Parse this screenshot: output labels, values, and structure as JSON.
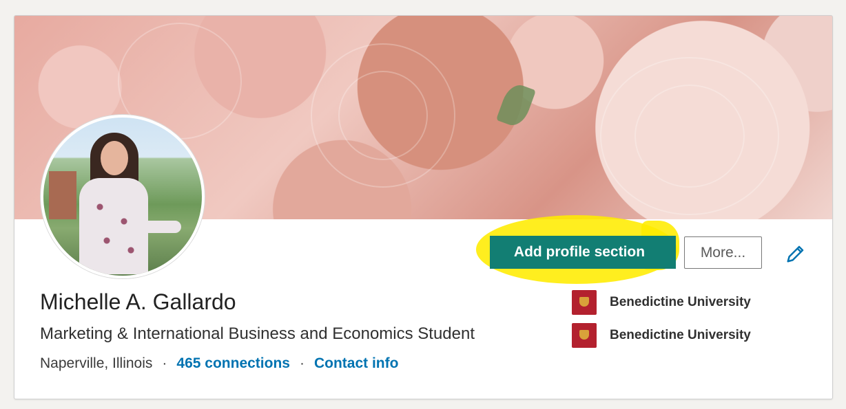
{
  "profile": {
    "name": "Michelle A. Gallardo",
    "headline": "Marketing & International Business and Economics Student",
    "location": "Naperville, Illinois",
    "connections": "465 connections",
    "contact_info": "Contact info",
    "separator": "·"
  },
  "actions": {
    "add_profile_section": "Add profile section",
    "more": "More...",
    "edit_icon": "pencil-icon"
  },
  "education": [
    {
      "school": "Benedictine University",
      "logo_text": "Benedictine University"
    },
    {
      "school": "Benedictine University",
      "logo_text": "Benedictine University"
    }
  ],
  "colors": {
    "accent": "#0073b1",
    "highlight": "#ffec00",
    "school_logo": "#b3212e"
  }
}
